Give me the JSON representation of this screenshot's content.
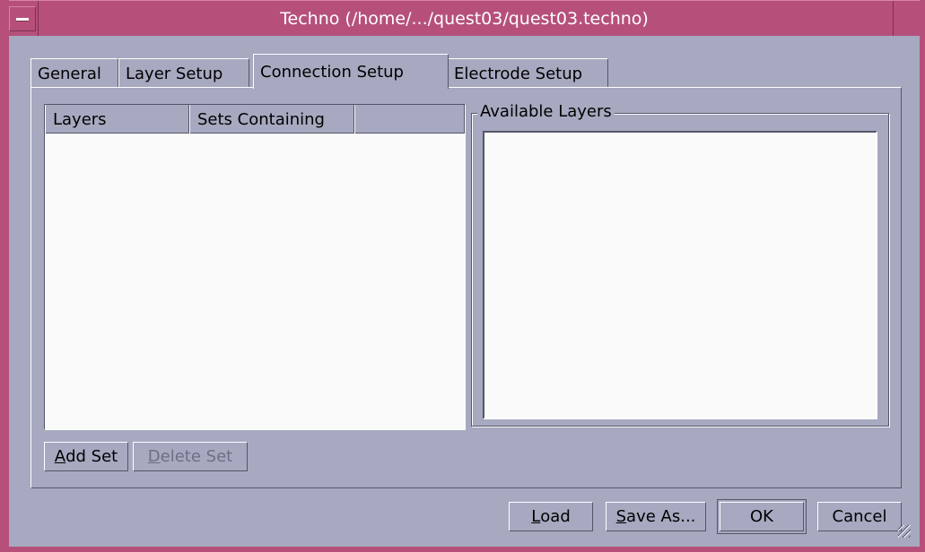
{
  "window": {
    "title": "Techno (/home/.../quest03/quest03.techno)"
  },
  "tabs": [
    {
      "label": "General",
      "active": false
    },
    {
      "label": "Layer Setup",
      "active": false
    },
    {
      "label": "Connection Setup",
      "active": true
    },
    {
      "label": "Electrode Setup",
      "active": false
    }
  ],
  "layers_table": {
    "columns": [
      "Layers",
      "Sets Containing",
      ""
    ],
    "rows": []
  },
  "available_layers": {
    "title": "Available Layers",
    "items": []
  },
  "panel_buttons": {
    "add_set": {
      "mnemonic": "A",
      "rest": "dd Set",
      "enabled": true
    },
    "delete_set": {
      "mnemonic": "D",
      "rest": "elete Set",
      "enabled": false
    }
  },
  "dialog_buttons": {
    "load": {
      "mnemonic": "L",
      "rest": "oad"
    },
    "save_as": {
      "mnemonic": "S",
      "rest": "ave As..."
    },
    "ok": {
      "label": "OK"
    },
    "cancel": {
      "label": "Cancel"
    }
  },
  "colors": {
    "titlebar": "#b6507b",
    "background": "#a7a9c0",
    "list_background": "#fafafa"
  }
}
